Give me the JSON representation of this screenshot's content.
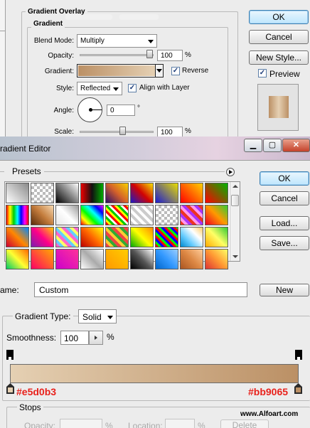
{
  "layer_style": {
    "section_title": "Gradient Overlay",
    "group_title": "Gradient",
    "blend_mode_label": "Blend Mode:",
    "blend_mode_value": "Multiply",
    "opacity_label": "Opacity:",
    "opacity_value": "100",
    "opacity_unit": "%",
    "opacity_level_pct": 100,
    "gradient_label": "Gradient:",
    "reverse_label": "Reverse",
    "reverse_checked": true,
    "style_label": "Style:",
    "style_value": "Reflected",
    "align_label": "Align with Layer",
    "align_checked": true,
    "angle_label": "Angle:",
    "angle_value": "0",
    "angle_unit": "°",
    "scale_label": "Scale:",
    "scale_value": "100",
    "scale_unit": "%",
    "scale_level_pct": 100,
    "ok_label": "OK",
    "cancel_label": "Cancel",
    "new_style_label": "New Style...",
    "preview_label": "Preview",
    "preview_checked": true
  },
  "gradient_editor": {
    "title": "radient Editor",
    "presets_label": "Presets",
    "ok_label": "OK",
    "cancel_label": "Cancel",
    "load_label": "Load...",
    "save_label": "Save...",
    "name_label": "ame:",
    "name_value": "Custom",
    "new_label": "New",
    "gradient_type_label": "Gradient Type:",
    "gradient_type_value": "Solid",
    "smoothness_label": "Smoothness:",
    "smoothness_value": "100",
    "smoothness_unit": "%",
    "stop_left_color": "#e5d0b3",
    "stop_right_color": "#bb9065",
    "stops_label": "Stops",
    "opacity_label": "Opacity:",
    "opacity_unit": "%",
    "location_label": "Location:",
    "location_unit": "%",
    "delete_label": "Delete",
    "watermark": "www.Alfoart.com"
  },
  "colors": {
    "gradient_start": "#e5d0b3",
    "gradient_end": "#bb9065",
    "annotation": "#e8211b"
  }
}
